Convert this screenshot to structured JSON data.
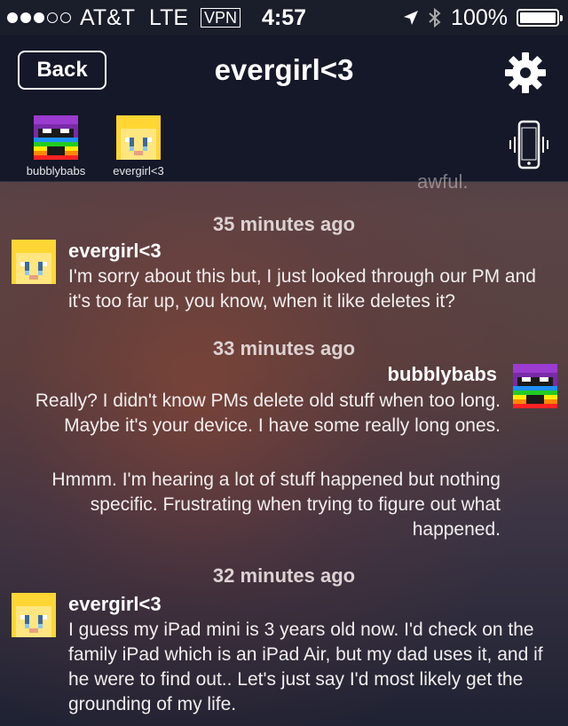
{
  "status_bar": {
    "carrier": "AT&T",
    "network": "LTE",
    "vpn": "VPN",
    "time": "4:57",
    "battery": "100%",
    "signal_bars_filled": 3,
    "signal_bars_total": 5
  },
  "nav": {
    "back_label": "Back",
    "title": "evergirl<3"
  },
  "participants": [
    {
      "name": "bubblybabs"
    },
    {
      "name": "evergirl<3"
    }
  ],
  "conversation": {
    "cut_off_text": "awful.",
    "groups": [
      {
        "timestamp": "35 minutes ago",
        "sender": "evergirl<3",
        "messages": [
          "I'm sorry about this but, I just looked through our PM and it's too far up, you know, when it like deletes it?"
        ]
      },
      {
        "timestamp": "33 minutes ago",
        "sender": "bubblybabs",
        "messages": [
          "Really?  I didn't know PMs delete old stuff  when too long.  Maybe it's your device.  I have some really long ones.",
          "Hmmm.  I'm hearing a lot of stuff happened but nothing specific.  Frustrating when trying to figure out what happened."
        ]
      },
      {
        "timestamp": "32 minutes ago",
        "sender": "evergirl<3",
        "messages": [
          "I guess my iPad mini is 3 years old now. I'd check on the family iPad which is an iPad Air, but my dad uses it, and if he were to find out.. Let's just say I'd most likely get the grounding of my life."
        ]
      }
    ]
  }
}
